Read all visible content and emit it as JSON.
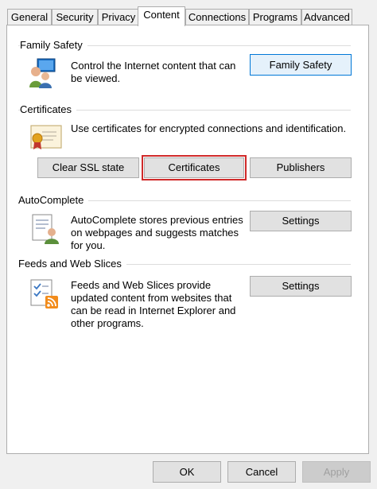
{
  "tabs": [
    "General",
    "Security",
    "Privacy",
    "Content",
    "Connections",
    "Programs",
    "Advanced"
  ],
  "active_tab": "Content",
  "family_safety": {
    "title": "Family Safety",
    "desc_line1": "Control the Internet content that can",
    "desc_line2": "be viewed.",
    "button": "Family Safety",
    "icon": "family-safety-icon"
  },
  "certificates": {
    "title": "Certificates",
    "desc": "Use certificates for encrypted connections and identification.",
    "clear_ssl": "Clear SSL state",
    "certificates_button": "Certificates",
    "publishers": "Publishers",
    "icon": "certificate-icon",
    "highlight_color": "#d02a2a"
  },
  "autocomplete": {
    "title": "AutoComplete",
    "desc_line1": "AutoComplete stores previous entries",
    "desc_line2": "on webpages and suggests matches",
    "desc_line3": "for you.",
    "button": "Settings",
    "icon": "autocomplete-icon"
  },
  "feeds": {
    "title": "Feeds and Web Slices",
    "desc_line1": "Feeds and Web Slices provide",
    "desc_line2": "updated content from websites that",
    "desc_line3": "can be read in Internet Explorer and",
    "desc_line4": "other programs.",
    "button": "Settings",
    "icon": "rss-feed-icon"
  },
  "footer": {
    "ok": "OK",
    "cancel": "Cancel",
    "apply": "Apply"
  }
}
